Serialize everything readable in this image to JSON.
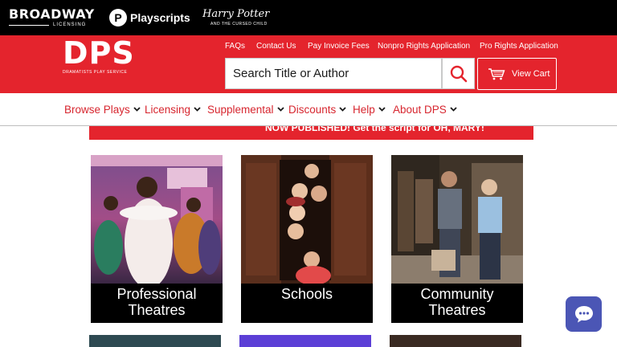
{
  "topbar": {
    "broadway": "BROADWAY",
    "broadway_sub": "LICENSING",
    "playscripts_p": "P",
    "playscripts": "Playscripts",
    "harry_potter": "Harry Potter",
    "harry_potter_sub": "AND THE CURSED CHILD"
  },
  "header": {
    "logo": "DPS",
    "logo_sub": "DRAMATISTS PLAY SERVICE",
    "utility_links": [
      {
        "label": "FAQs"
      },
      {
        "label": "Contact Us"
      },
      {
        "label": "Pay Invoice Fees"
      },
      {
        "label": "Nonpro Rights Application"
      },
      {
        "label": "Pro Rights Application"
      }
    ],
    "search_placeholder": "Search Title or Author",
    "cart_label": "View Cart"
  },
  "nav": {
    "items": [
      {
        "label": "Browse Plays"
      },
      {
        "label": "Licensing"
      },
      {
        "label": "Supplemental"
      },
      {
        "label": "Discounts"
      },
      {
        "label": "Help"
      },
      {
        "label": "About DPS"
      }
    ]
  },
  "announcement": "NOW PUBLISHED! Get the script for OH, MARY!",
  "cards": [
    {
      "label": "Professional Theatres"
    },
    {
      "label": "Schools"
    },
    {
      "label": "Community Theatres"
    }
  ],
  "colors": {
    "brand_red": "#e4242d",
    "nav_red": "#d7262f",
    "chat_blue": "#4b56b5"
  },
  "icons": {
    "search": "search-icon",
    "cart": "cart-icon",
    "chevron": "chevron-down-icon",
    "chat": "chat-icon"
  }
}
